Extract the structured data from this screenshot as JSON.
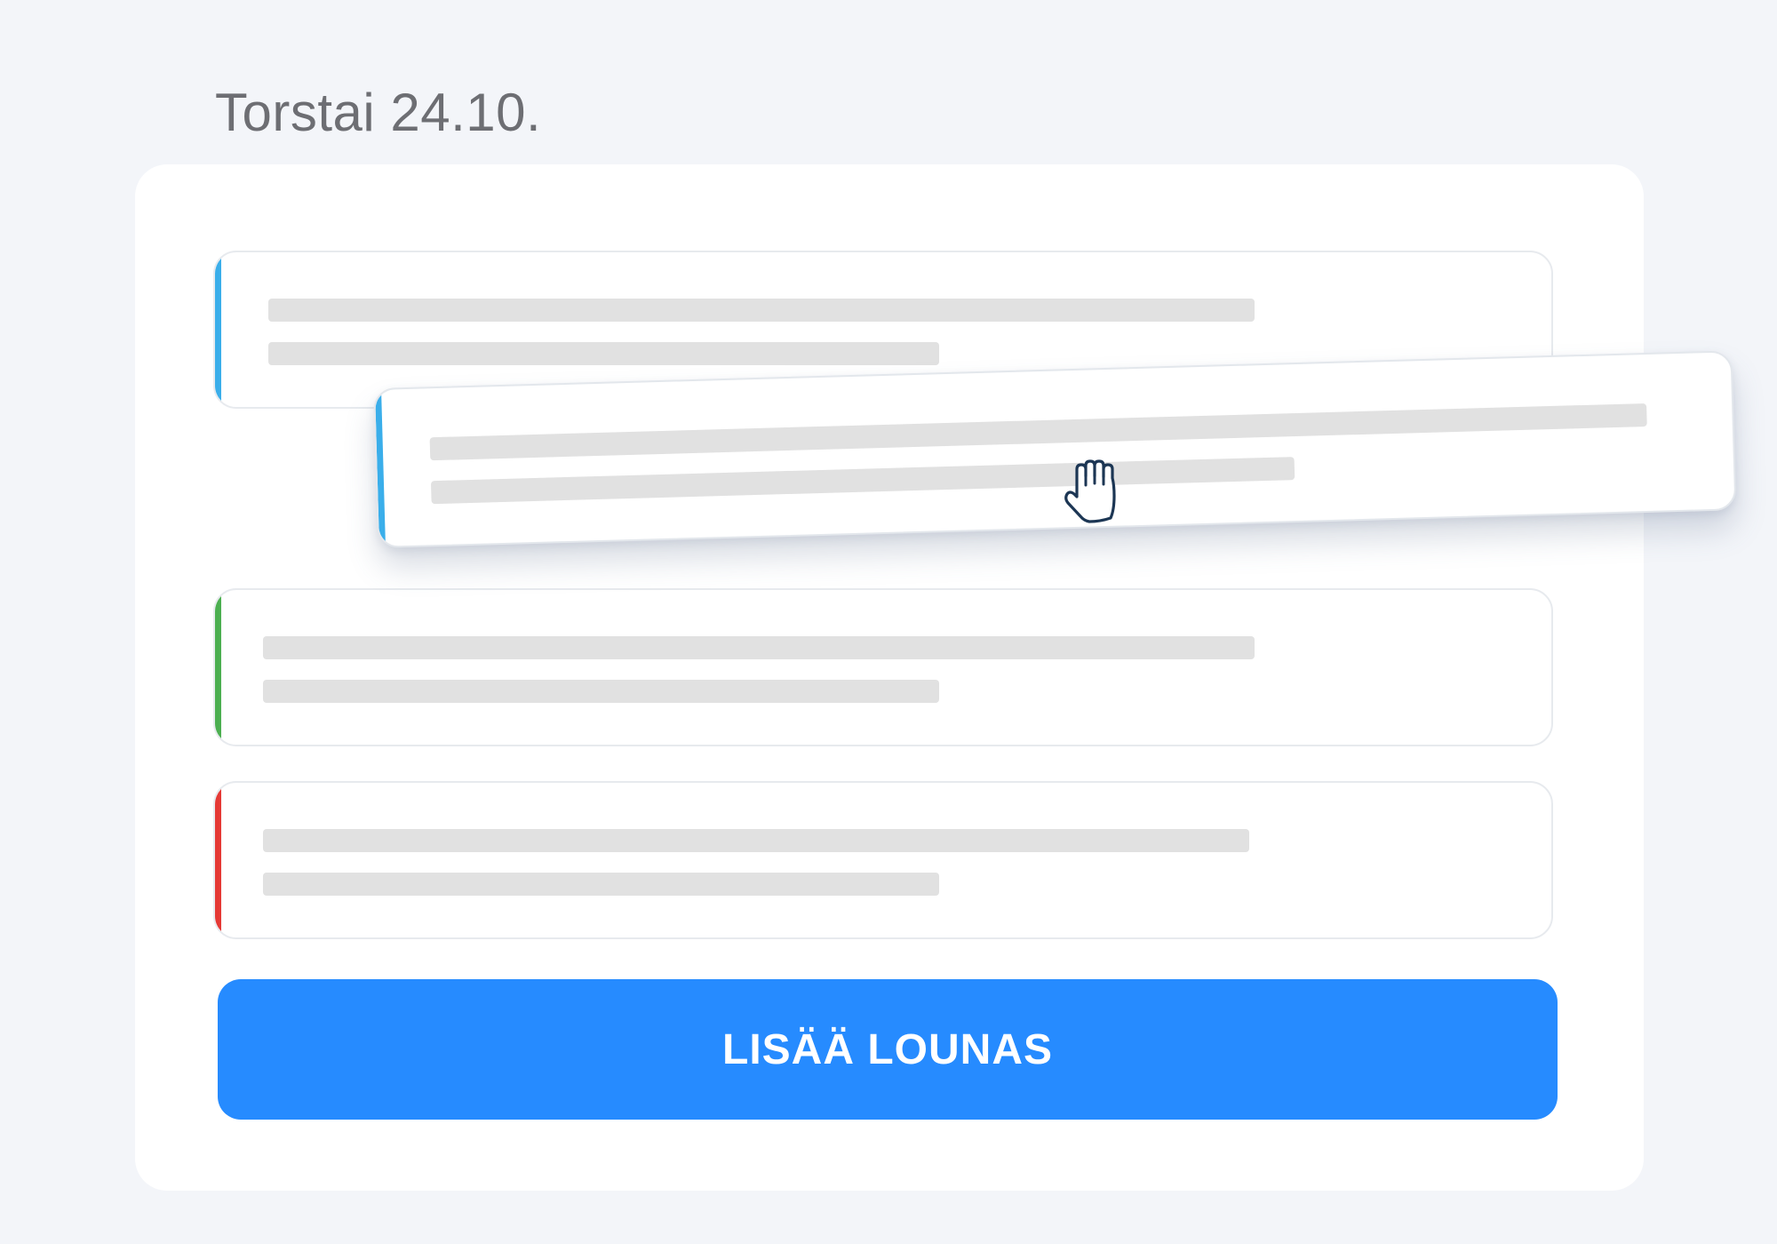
{
  "header": {
    "day_title": "Torstai 24.10."
  },
  "lunch_list": {
    "cards": [
      {
        "accent_color": "#3aaeea",
        "state": "static"
      },
      {
        "accent_color": "#3aaeea",
        "state": "dragging"
      },
      {
        "accent_color": "#4caf50",
        "state": "static"
      },
      {
        "accent_color": "#e53935",
        "state": "static"
      }
    ]
  },
  "cursor": {
    "icon": "grab-hand-icon"
  },
  "actions": {
    "add_lunch_label": "LISÄÄ LOUNAS",
    "add_lunch_color": "#268bff"
  }
}
